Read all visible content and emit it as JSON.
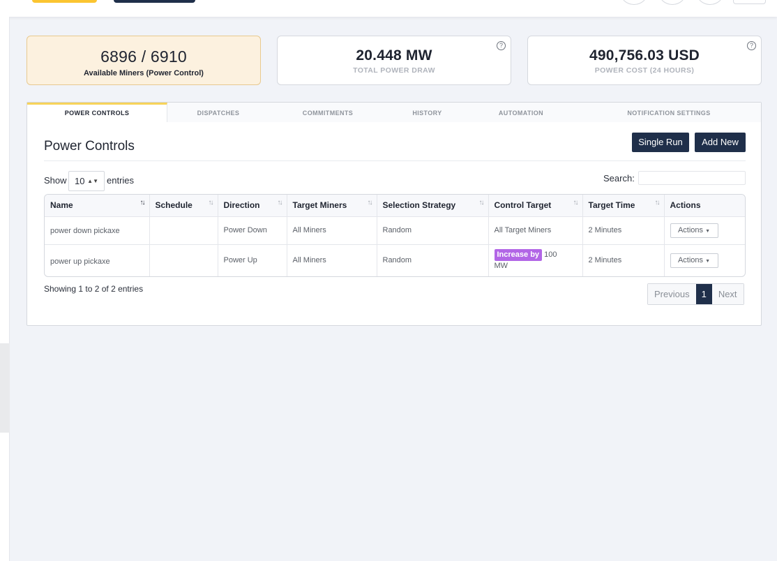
{
  "stats": {
    "miners_value": "6896 / 6910",
    "miners_label": "Available Miners (Power Control)",
    "power_value": "20.448 MW",
    "power_label": "TOTAL POWER DRAW",
    "cost_value": "490,756.03 USD",
    "cost_label": "POWER COST (24 HOURS)",
    "help_glyph": "?"
  },
  "tabs": [
    {
      "label": "POWER CONTROLS"
    },
    {
      "label": "DISPATCHES"
    },
    {
      "label": "COMMITMENTS"
    },
    {
      "label": "HISTORY"
    },
    {
      "label": "AUTOMATION"
    },
    {
      "label": "NOTIFICATION SETTINGS"
    }
  ],
  "panel": {
    "title": "Power Controls",
    "single_run_label": "Single Run",
    "add_new_label": "Add New",
    "show_label": "Show",
    "entries_count": "10",
    "entries_label": "entries",
    "search_label": "Search:",
    "search_value": ""
  },
  "table": {
    "headers": [
      "Name",
      "Schedule",
      "Direction",
      "Target Miners",
      "Selection Strategy",
      "Control Target",
      "Target Time",
      "Actions"
    ],
    "rows": [
      {
        "name": "power down pickaxe",
        "schedule": "",
        "direction": "Power Down",
        "target_miners": "All Miners",
        "strategy": "Random",
        "control_target": "All Target Miners",
        "target_time": "2 Minutes",
        "actions": "Actions"
      },
      {
        "name": "power up pickaxe",
        "schedule": "",
        "direction": "Power Up",
        "target_miners": "All Miners",
        "strategy": "Random",
        "control_badge": "Increase by",
        "control_value": "100 MW",
        "target_time": "2 Minutes",
        "actions": "Actions"
      }
    ]
  },
  "footer": {
    "showing_text": "Showing 1 to 2 of 2 entries",
    "previous_label": "Previous",
    "current_page": "1",
    "next_label": "Next"
  },
  "colors": {
    "accent_yellow": "#fbc531",
    "navy": "#1f2f4a",
    "badge_purple": "#b266e6",
    "highlight_bg": "#fcf1df"
  }
}
